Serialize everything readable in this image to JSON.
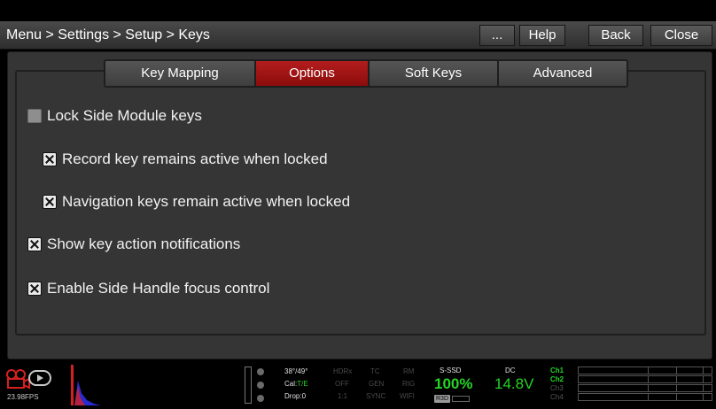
{
  "breadcrumb": "Menu > Settings > Setup > Keys",
  "title_buttons": {
    "more": "...",
    "help": "Help",
    "back": "Back",
    "close": "Close"
  },
  "tabs": [
    {
      "label": "Key Mapping"
    },
    {
      "label": "Options"
    },
    {
      "label": "Soft Keys"
    },
    {
      "label": "Advanced"
    }
  ],
  "active_tab": "Options",
  "options": [
    {
      "label": "Lock Side Module keys",
      "checked": false
    },
    {
      "label": "Record key remains active when locked",
      "checked": true
    },
    {
      "label": "Navigation keys remain active when locked",
      "checked": true
    },
    {
      "label": "Show key action notifications",
      "checked": true
    },
    {
      "label": "Enable Side Handle focus control",
      "checked": true
    }
  ],
  "status": {
    "fps": "23.98FPS",
    "temp": "38°/49°",
    "cal_label": "Cal:",
    "cal_value": "T/E",
    "drop": "Drop:0",
    "hdrx": "HDRx",
    "hdrx_val": "OFF",
    "hdrx_ratio": "1:1",
    "tc": "TC",
    "tc_gen": "GEN",
    "tc_sync": "SYNC",
    "rm": "RM",
    "rm_rig": "RIG",
    "rm_wifi": "WIFI",
    "media": "S-SSD",
    "media_pct": "100%",
    "media_tag": "R3D",
    "power": "DC",
    "voltage": "14.8V",
    "ch1": "Ch1",
    "ch2": "Ch2",
    "ch3": "Ch3",
    "ch4": "Ch4"
  },
  "colors": {
    "active_tab": "#a31414",
    "status_green": "#25d425",
    "accent_red": "#d62020"
  }
}
